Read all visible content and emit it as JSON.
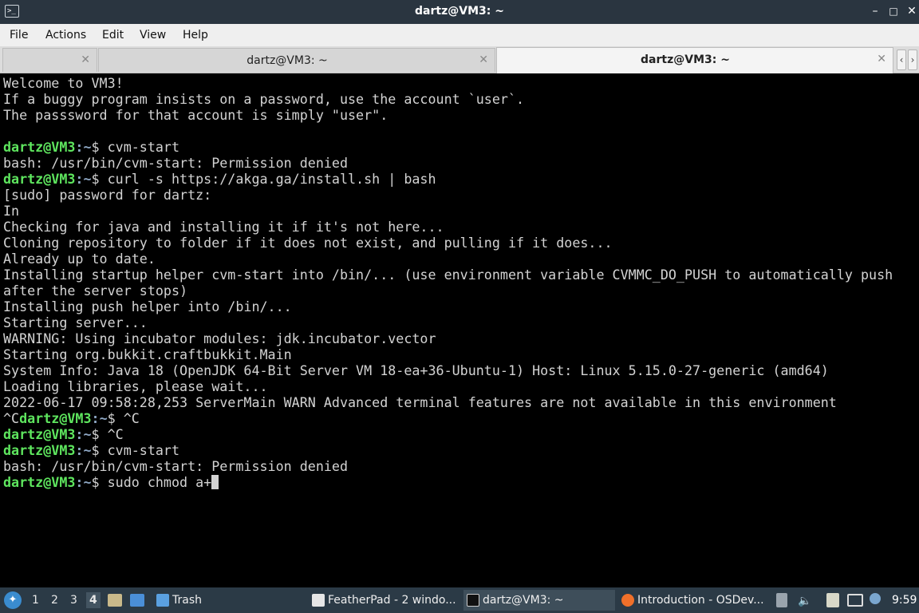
{
  "window": {
    "title": "dartz@VM3: ~",
    "icon": "terminal-icon",
    "buttons": {
      "minimize": "–",
      "maximize": "□",
      "close": "✕"
    }
  },
  "menu": {
    "items": [
      "File",
      "Actions",
      "Edit",
      "View",
      "Help"
    ]
  },
  "tabs": [
    {
      "label": "",
      "close": "✕",
      "active": false
    },
    {
      "label": "dartz@VM3: ~",
      "close": "✕",
      "active": false
    },
    {
      "label": "dartz@VM3: ~",
      "close": "✕",
      "active": true
    }
  ],
  "tab_scroll": {
    "left": "‹",
    "right": "›"
  },
  "terminal": {
    "text_color": "#d3d3d3",
    "prompt_user_color": "#5ee55e",
    "prompt_path_color": "#8ea7c4",
    "lines": [
      {
        "type": "text",
        "text": "Welcome to VM3!"
      },
      {
        "type": "text",
        "text": "If a buggy program insists on a password, use the account `user`."
      },
      {
        "type": "text",
        "text": "The passsword for that account is simply \"user\"."
      },
      {
        "type": "text",
        "text": ""
      },
      {
        "type": "prompt",
        "pre": "",
        "user": "dartz@VM3",
        "sep": ":",
        "path": "~",
        "cmd": "$ cvm-start"
      },
      {
        "type": "text",
        "text": "bash: /usr/bin/cvm-start: Permission denied"
      },
      {
        "type": "prompt",
        "pre": "",
        "user": "dartz@VM3",
        "sep": ":",
        "path": "~",
        "cmd": "$ curl -s https://akga.ga/install.sh | bash"
      },
      {
        "type": "text",
        "text": "[sudo] password for dartz:"
      },
      {
        "type": "text",
        "text": "In"
      },
      {
        "type": "text",
        "text": "Checking for java and installing it if it's not here..."
      },
      {
        "type": "text",
        "text": "Cloning repository to folder if it does not exist, and pulling if it does..."
      },
      {
        "type": "text",
        "text": "Already up to date."
      },
      {
        "type": "text",
        "text": "Installing startup helper cvm-start into /bin/... (use environment variable CVMMC_DO_PUSH to automatically push"
      },
      {
        "type": "text",
        "text": "after the server stops)"
      },
      {
        "type": "text",
        "text": "Installing push helper into /bin/..."
      },
      {
        "type": "text",
        "text": "Starting server..."
      },
      {
        "type": "text",
        "text": "WARNING: Using incubator modules: jdk.incubator.vector"
      },
      {
        "type": "text",
        "text": "Starting org.bukkit.craftbukkit.Main"
      },
      {
        "type": "text",
        "text": "System Info: Java 18 (OpenJDK 64-Bit Server VM 18-ea+36-Ubuntu-1) Host: Linux 5.15.0-27-generic (amd64)"
      },
      {
        "type": "text",
        "text": "Loading libraries, please wait..."
      },
      {
        "type": "text",
        "text": "2022-06-17 09:58:28,253 ServerMain WARN Advanced terminal features are not available in this environment"
      },
      {
        "type": "prompt",
        "pre": "^C",
        "user": "dartz@VM3",
        "sep": ":",
        "path": "~",
        "cmd": "$ ^C"
      },
      {
        "type": "prompt",
        "pre": "",
        "user": "dartz@VM3",
        "sep": ":",
        "path": "~",
        "cmd": "$ ^C"
      },
      {
        "type": "prompt",
        "pre": "",
        "user": "dartz@VM3",
        "sep": ":",
        "path": "~",
        "cmd": "$ cvm-start"
      },
      {
        "type": "text",
        "text": "bash: /usr/bin/cvm-start: Permission denied"
      },
      {
        "type": "prompt",
        "pre": "",
        "user": "dartz@VM3",
        "sep": ":",
        "path": "~",
        "cmd": "$ sudo chmod a+",
        "cursor": true
      }
    ]
  },
  "taskbar": {
    "start_icon": "start-menu-icon",
    "workspaces": [
      "1",
      "2",
      "3",
      "4"
    ],
    "active_workspace": "4",
    "quick_launch": [
      "file-manager-icon",
      "show-desktop-icon"
    ],
    "trash": "Trash",
    "tasks": [
      {
        "label": "FeatherPad - 2 windo...",
        "icon": "featherpad-icon"
      },
      {
        "label": "dartz@VM3: ~",
        "icon": "terminal-icon"
      },
      {
        "label": "Introduction - OSDev...",
        "icon": "firefox-icon"
      }
    ],
    "clock": "9:59"
  }
}
